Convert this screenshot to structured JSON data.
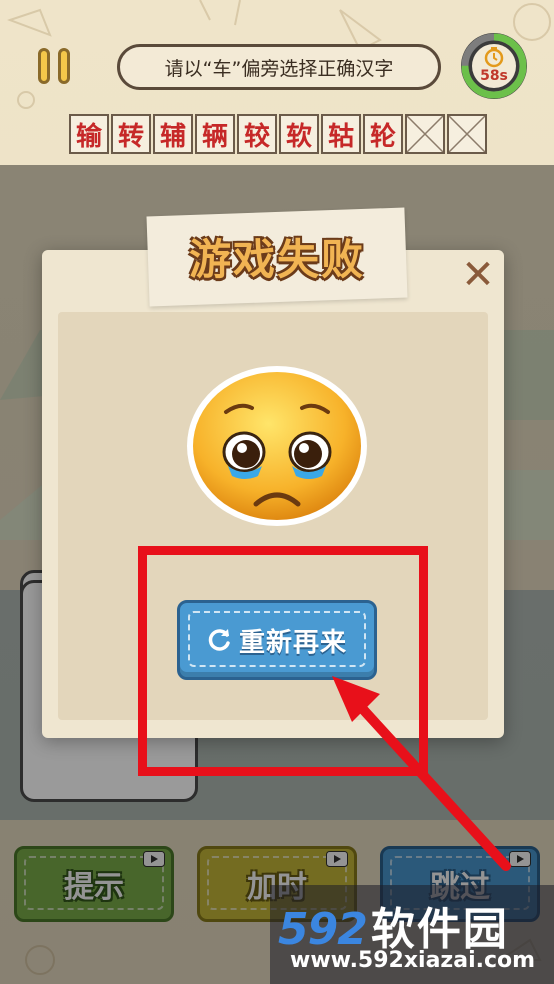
{
  "hud": {
    "prompt": "请以“车”偏旁选择正确汉字",
    "timer": "58s",
    "timer_progress": 0.75
  },
  "answer_row": {
    "chars": [
      "输",
      "转",
      "辅",
      "辆",
      "较",
      "软",
      "轱",
      "轮",
      "",
      ""
    ]
  },
  "modal": {
    "title": "游戏失败",
    "emoji": "pleading-crying-face-icon",
    "retry_label": "重新再来"
  },
  "bottom": {
    "hint_label": "提示",
    "time_label": "加时",
    "skip_label": "跳过"
  },
  "watermark": {
    "logo_num": "592",
    "logo_cn": "软件园",
    "url": "www.592xiazai.com"
  },
  "colors": {
    "annotation": "#e8101a",
    "primary_button": "#4a9ad2",
    "hint_button": "#7db04a",
    "time_button": "#c8bb3a",
    "title_fill": "#f1b453"
  }
}
